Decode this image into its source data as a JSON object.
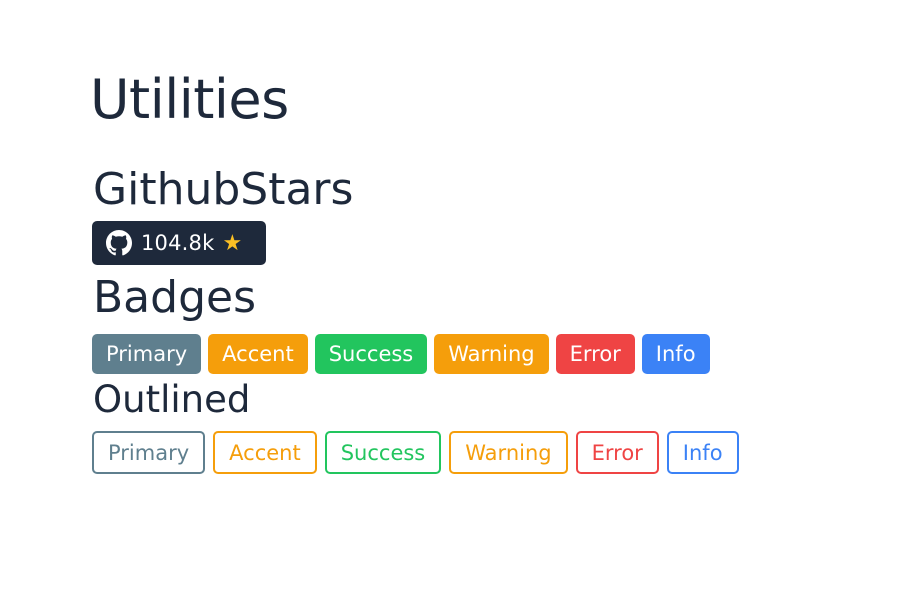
{
  "page": {
    "title": "Utilities"
  },
  "sections": {
    "github_stars": {
      "title": "GithubStars",
      "count": "104.8k",
      "icons": [
        "github-icon",
        "star-icon"
      ],
      "background": "#1e293b",
      "star_color": "#fbbf24"
    },
    "badges": {
      "title": "Badges",
      "items": [
        {
          "label": "Primary",
          "color": "#5f7f8e"
        },
        {
          "label": "Accent",
          "color": "#f59e0b"
        },
        {
          "label": "Success",
          "color": "#22c55e"
        },
        {
          "label": "Warning",
          "color": "#f59e0b"
        },
        {
          "label": "Error",
          "color": "#ef4444"
        },
        {
          "label": "Info",
          "color": "#3b82f6"
        }
      ]
    },
    "outlined": {
      "title": "Outlined",
      "items": [
        {
          "label": "Primary",
          "color": "#5f7f8e"
        },
        {
          "label": "Accent",
          "color": "#f59e0b"
        },
        {
          "label": "Success",
          "color": "#22c55e"
        },
        {
          "label": "Warning",
          "color": "#f59e0b"
        },
        {
          "label": "Error",
          "color": "#ef4444"
        },
        {
          "label": "Info",
          "color": "#3b82f6"
        }
      ]
    }
  }
}
